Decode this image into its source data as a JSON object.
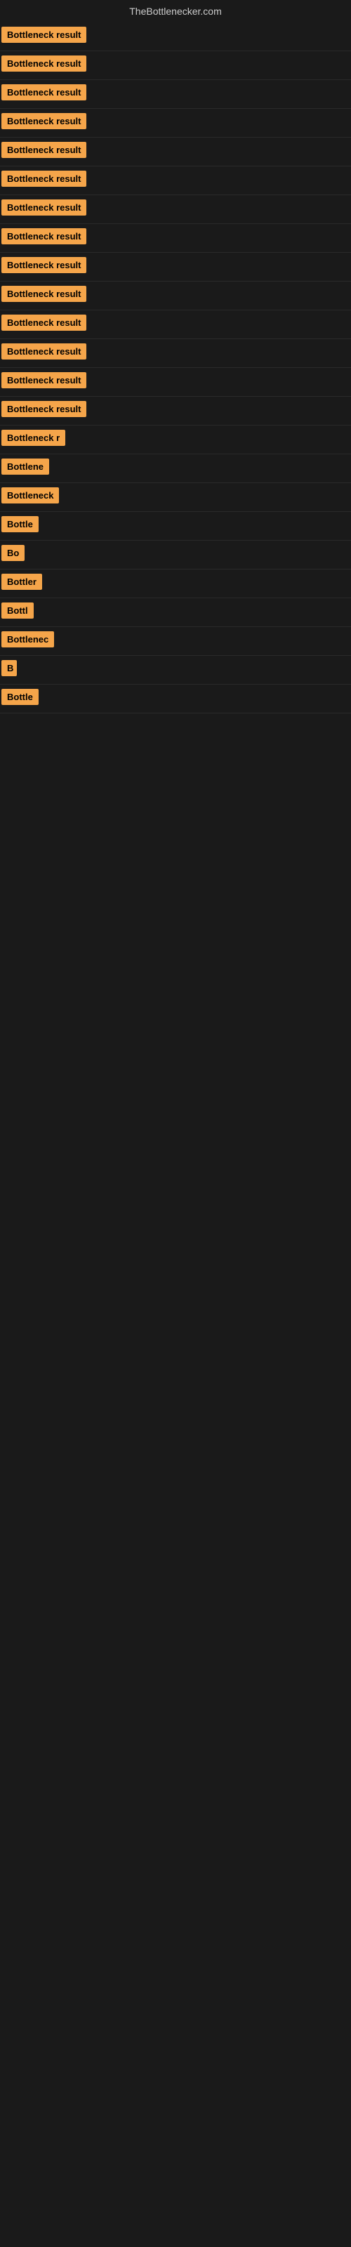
{
  "site": {
    "title": "TheBottlenecker.com"
  },
  "rows": [
    {
      "label": "Bottleneck result",
      "width": 130
    },
    {
      "label": "Bottleneck result",
      "width": 130
    },
    {
      "label": "Bottleneck result",
      "width": 130
    },
    {
      "label": "Bottleneck result",
      "width": 130
    },
    {
      "label": "Bottleneck result",
      "width": 130
    },
    {
      "label": "Bottleneck result",
      "width": 130
    },
    {
      "label": "Bottleneck result",
      "width": 130
    },
    {
      "label": "Bottleneck result",
      "width": 130
    },
    {
      "label": "Bottleneck result",
      "width": 130
    },
    {
      "label": "Bottleneck result",
      "width": 130
    },
    {
      "label": "Bottleneck result",
      "width": 130
    },
    {
      "label": "Bottleneck result",
      "width": 130
    },
    {
      "label": "Bottleneck result",
      "width": 130
    },
    {
      "label": "Bottleneck result",
      "width": 130
    },
    {
      "label": "Bottleneck r",
      "width": 100
    },
    {
      "label": "Bottlene",
      "width": 84
    },
    {
      "label": "Bottleneck",
      "width": 90
    },
    {
      "label": "Bottle",
      "width": 72
    },
    {
      "label": "Bo",
      "width": 34
    },
    {
      "label": "Bottler",
      "width": 74
    },
    {
      "label": "Bottl",
      "width": 62
    },
    {
      "label": "Bottlenec",
      "width": 88
    },
    {
      "label": "B",
      "width": 22
    },
    {
      "label": "Bottle",
      "width": 72
    }
  ]
}
